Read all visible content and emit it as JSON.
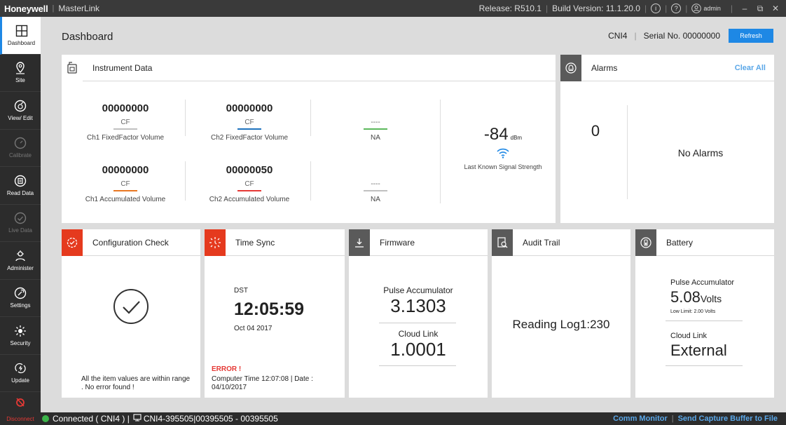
{
  "titlebar": {
    "brand": "Honeywell",
    "app": "MasterLink",
    "release": "Release: R510.1",
    "build": "Build Version: 11.1.20.0",
    "info_glyph": "i",
    "help_glyph": "?",
    "user": "admin",
    "minimize": "–",
    "restore": "⧉",
    "close": "✕"
  },
  "sidebar": {
    "items": [
      {
        "label": "Dashboard",
        "icon": "dashboard-icon"
      },
      {
        "label": "Site",
        "icon": "location-pin-icon"
      },
      {
        "label": "View/ Edit",
        "icon": "view-edit-icon"
      },
      {
        "label": "Calibrate",
        "icon": "calibrate-icon"
      },
      {
        "label": "Read Data",
        "icon": "read-data-icon"
      },
      {
        "label": "Live Data",
        "icon": "live-data-icon"
      },
      {
        "label": "Administer",
        "icon": "administer-icon"
      },
      {
        "label": "Settings",
        "icon": "settings-icon"
      },
      {
        "label": "Security",
        "icon": "security-icon"
      },
      {
        "label": "Update",
        "icon": "update-icon"
      }
    ],
    "disconnect": "Disconnect"
  },
  "header": {
    "title": "Dashboard",
    "device": "CNI4",
    "serial": "Serial No. 00000000",
    "refresh": "Refresh"
  },
  "instrument": {
    "title": "Instrument Data",
    "cells": [
      {
        "value": "00000000",
        "unit": "CF",
        "label": "Ch1 FixedFactor Volume",
        "color": "#c0c0c0"
      },
      {
        "value": "00000000",
        "unit": "CF",
        "label": "Ch2 FixedFactor Volume",
        "color": "#1e73be"
      },
      {
        "value": "",
        "unit": "----",
        "label": "NA",
        "color": "#5cb85c"
      },
      {
        "value": "00000000",
        "unit": "CF",
        "label": "Ch1 Accumulated Volume",
        "color": "#e87722"
      },
      {
        "value": "00000050",
        "unit": "CF",
        "label": "Ch2 Accumulated Volume",
        "color": "#e53935"
      },
      {
        "value": "",
        "unit": "----",
        "label": "NA",
        "color": "#c0c0c0"
      }
    ],
    "signal_value": "-84",
    "signal_unit": "dBm",
    "signal_label": "Last Known Signal Strength"
  },
  "alarms": {
    "title": "Alarms",
    "clear_all": "Clear All",
    "count": "0",
    "status": "No Alarms"
  },
  "config": {
    "title": "Configuration Check",
    "message": "All the item values are within range . No error found !"
  },
  "timesync": {
    "title": "Time Sync",
    "dst": "DST",
    "time": "12:05:59",
    "date": "Oct 04 2017",
    "error": "ERROR !",
    "computer_time": "Computer Time 12:07:08  |  Date : 04/10/2017"
  },
  "firmware": {
    "title": "Firmware",
    "label1": "Pulse Accumulator",
    "value1": "3.1303",
    "label2": "Cloud Link",
    "value2": "1.0001"
  },
  "audit": {
    "title": "Audit Trail",
    "reading": "Reading Log1:230"
  },
  "battery": {
    "title": "Battery",
    "label1": "Pulse Accumulator",
    "volts_value": "5.08",
    "volts_unit": "Volts",
    "low_limit": "Low Limit: 2.00 Volts",
    "label2": "Cloud Link",
    "value2": "External"
  },
  "footer": {
    "disconnect": "Disconnect",
    "status": "Connected  ( CNI4 ) |",
    "device_info": "CNI4-395505|00395505 - 00395505",
    "comm_monitor": "Comm Monitor",
    "send_capture": "Send Capture Buffer to File"
  },
  "colors": {
    "accent": "#1e88e5",
    "alert": "#e53a1e",
    "connected": "#3cb44a"
  }
}
